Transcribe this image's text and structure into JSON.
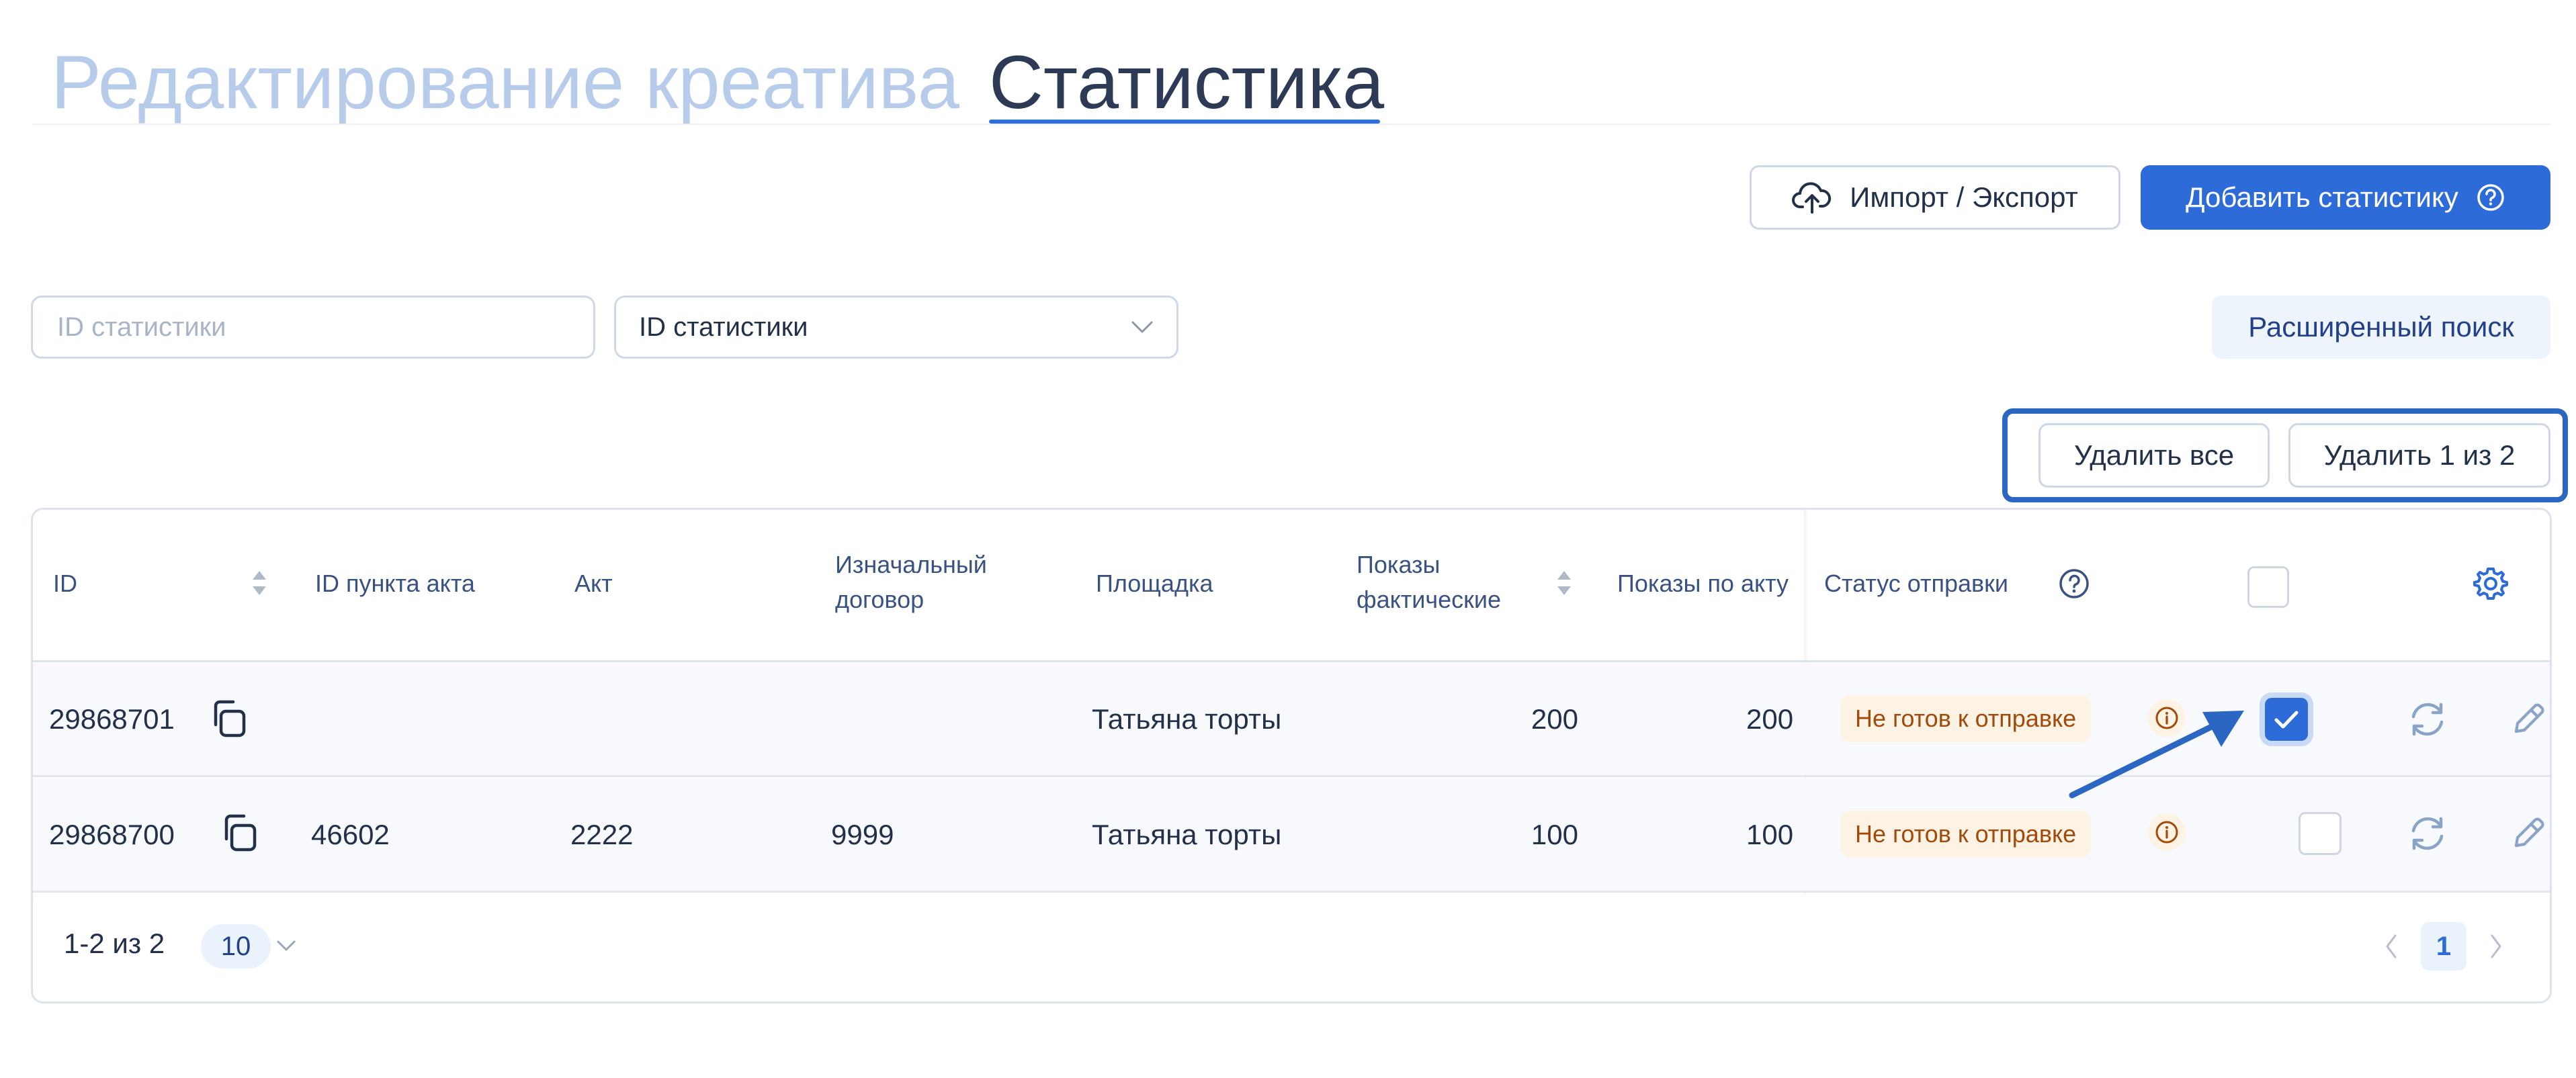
{
  "tabs": {
    "edit_creative": "Редактирование креатива",
    "statistics": "Статистика"
  },
  "toolbar": {
    "import_export": "Импорт / Экспорт",
    "add_statistics": "Добавить статистику"
  },
  "filters": {
    "search_placeholder": "ID статистики",
    "select_value": "ID статистики",
    "advanced_search": "Расширенный поиск"
  },
  "bulk_actions": {
    "delete_all": "Удалить все",
    "delete_selected": "Удалить 1 из 2"
  },
  "table": {
    "columns": {
      "id": "ID",
      "act_item_id": "ID пункта акта",
      "act": "Акт",
      "original_contract_line1": "Изначальный",
      "original_contract_line2": "договор",
      "platform": "Площадка",
      "impressions_actual_line1": "Показы",
      "impressions_actual_line2": "фактические",
      "impressions_by_act": "Показы по акту",
      "send_status": "Статус отправки"
    },
    "rows": [
      {
        "id": "29868701",
        "act_item_id": "",
        "act": "",
        "original_contract": "",
        "platform": "Татьяна торты",
        "impressions_actual": "200",
        "impressions_by_act": "200",
        "status": "Не готов к отправке",
        "selected": true
      },
      {
        "id": "29868700",
        "act_item_id": "46602",
        "act": "2222",
        "original_contract": "9999",
        "platform": "Татьяна торты",
        "impressions_actual": "100",
        "impressions_by_act": "100",
        "status": "Не готов к отправке",
        "selected": false
      }
    ]
  },
  "pagination": {
    "range": "1-2 из 2",
    "page_size": "10",
    "current_page": "1"
  },
  "colors": {
    "accent": "#2d6bd9",
    "highlight_border": "#2b66c2",
    "status_bg": "#fdf3e5",
    "status_text": "#a24a0a",
    "inactive_tab": "#b7cbea"
  },
  "icons": [
    "cloud-upload-icon",
    "help-circle-icon",
    "chevron-down-icon",
    "copy-icon",
    "sort-icon",
    "info-icon",
    "refresh-icon",
    "pencil-icon",
    "gear-icon",
    "arrow-annotation",
    "chevron-left-icon",
    "chevron-right-icon"
  ]
}
